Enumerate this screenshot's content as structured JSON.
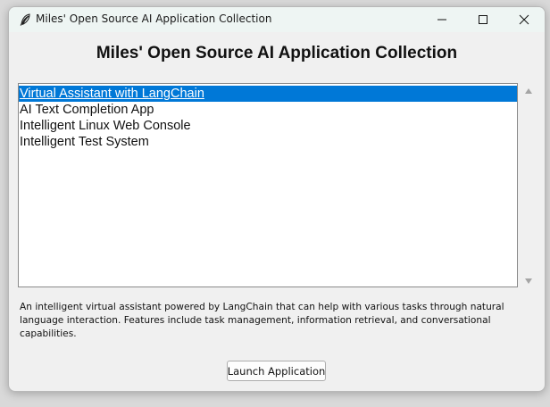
{
  "window": {
    "title": "Miles' Open Source AI Application Collection",
    "icon": "feather-icon",
    "controls": [
      "minimize-icon",
      "maximize-icon",
      "close-icon"
    ]
  },
  "main": {
    "heading": "Miles' Open Source AI Application Collection",
    "apps": [
      "Virtual Assistant with LangChain",
      "AI Text Completion App",
      "Intelligent Linux Web Console",
      "Intelligent Test System"
    ],
    "selected_index": 0,
    "description": "An intelligent virtual assistant powered by LangChain that can help with various tasks through natural language interaction. Features include task management, information retrieval, and conversational capabilities.",
    "launch_label": "Launch Application"
  },
  "colors": {
    "selection": "#0078d7",
    "titlebar": "#eef5f3",
    "window_bg": "#f0f0f0"
  }
}
